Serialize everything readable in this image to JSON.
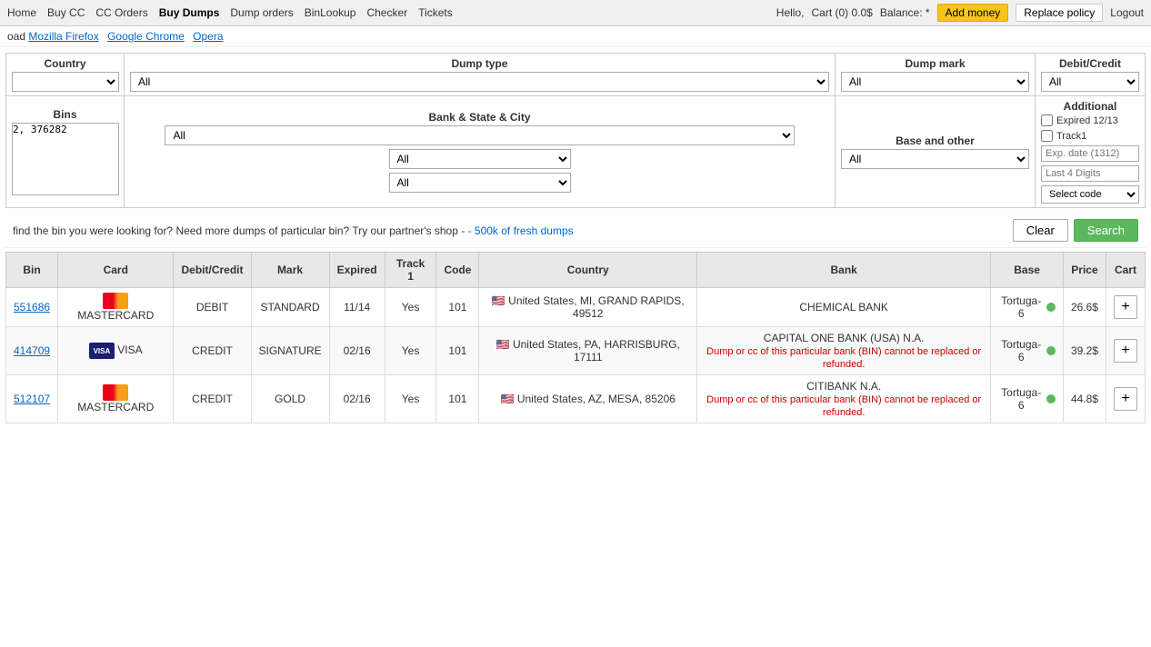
{
  "nav": {
    "left_items": [
      {
        "label": "Home",
        "active": false
      },
      {
        "label": "Buy CC",
        "active": false
      },
      {
        "label": "CC Orders",
        "active": false
      },
      {
        "label": "Buy Dumps",
        "active": true
      },
      {
        "label": "Dump orders",
        "active": false
      },
      {
        "label": "BinLookup",
        "active": false
      },
      {
        "label": "Checker",
        "active": false
      },
      {
        "label": "Tickets",
        "active": false
      }
    ],
    "hello_text": "Hello,",
    "cart_text": "Cart (0) 0.0$",
    "balance_text": "Balance: *",
    "add_money": "Add money",
    "replace_policy": "Replace policy",
    "logout": "Logout"
  },
  "download_bar": {
    "prefix": "oad",
    "links": [
      {
        "label": "Mozilla Firefox"
      },
      {
        "label": "Google Chrome"
      },
      {
        "label": "Opera"
      }
    ]
  },
  "filters": {
    "country_label": "Country",
    "dump_type_label": "Dump type",
    "dump_mark_label": "Dump mark",
    "debit_credit_label": "Debit/Credit",
    "bins_label": "Bins",
    "bank_label": "Bank & State & City",
    "base_label": "Base and other",
    "additional_label": "Additional",
    "dump_type_value": "All",
    "dump_mark_value": "All",
    "debit_credit_value": "All",
    "bank_value": "All",
    "base_value": "All",
    "bank_state_value": "All",
    "city_value": "All",
    "bins_value": "2, 376282",
    "expired_label": "Expired 12/13",
    "track1_label": "Track1",
    "exp_date_placeholder": "Exp. date (1312)",
    "last4_placeholder": "Last 4 Digits",
    "select_code_label": "Select code"
  },
  "search_bar": {
    "message": "find the bin you were looking for? Need more dumps of particular bin? Try our partner's shop -",
    "partner_link": "- 500k of fresh dumps",
    "clear_label": "Clear",
    "search_label": "Search"
  },
  "table": {
    "headers": [
      "Bin",
      "Card",
      "Debit/Credit",
      "Mark",
      "Expired",
      "Track 1",
      "Code",
      "Country",
      "Bank",
      "Base",
      "Price",
      "Cart"
    ],
    "rows": [
      {
        "bin": "551686",
        "card_type": "MASTERCARD",
        "card_icon": "mc",
        "debit_credit": "DEBIT",
        "mark": "STANDARD",
        "expired": "11/14",
        "track1": "Yes",
        "code": "101",
        "flag": "🇺🇸",
        "country": "United States, MI, GRAND RAPIDS, 49512",
        "bank": "CHEMICAL BANK",
        "bank_warning": "",
        "base": "Tortuga-6",
        "price": "26.6$",
        "has_cart": true
      },
      {
        "bin": "414709",
        "card_type": "VISA",
        "card_icon": "visa",
        "debit_credit": "CREDIT",
        "mark": "SIGNATURE",
        "expired": "02/16",
        "track1": "Yes",
        "code": "101",
        "flag": "🇺🇸",
        "country": "United States, PA, HARRISBURG, 17111",
        "bank": "CAPITAL ONE BANK (USA) N.A.",
        "bank_warning": "Dump or cc of this particular bank (BIN) cannot be replaced or refunded.",
        "base": "Tortuga-6",
        "price": "39.2$",
        "has_cart": true
      },
      {
        "bin": "512107",
        "card_type": "MASTERCARD",
        "card_icon": "mc",
        "debit_credit": "CREDIT",
        "mark": "GOLD",
        "expired": "02/16",
        "track1": "Yes",
        "code": "101",
        "flag": "🇺🇸",
        "country": "United States, AZ, MESA, 85206",
        "bank": "CITIBANK N.A.",
        "bank_warning": "Dump or cc of this particular bank (BIN) cannot be replaced or refunded.",
        "base": "Tortuga-6",
        "price": "44.8$",
        "has_cart": true
      }
    ]
  }
}
